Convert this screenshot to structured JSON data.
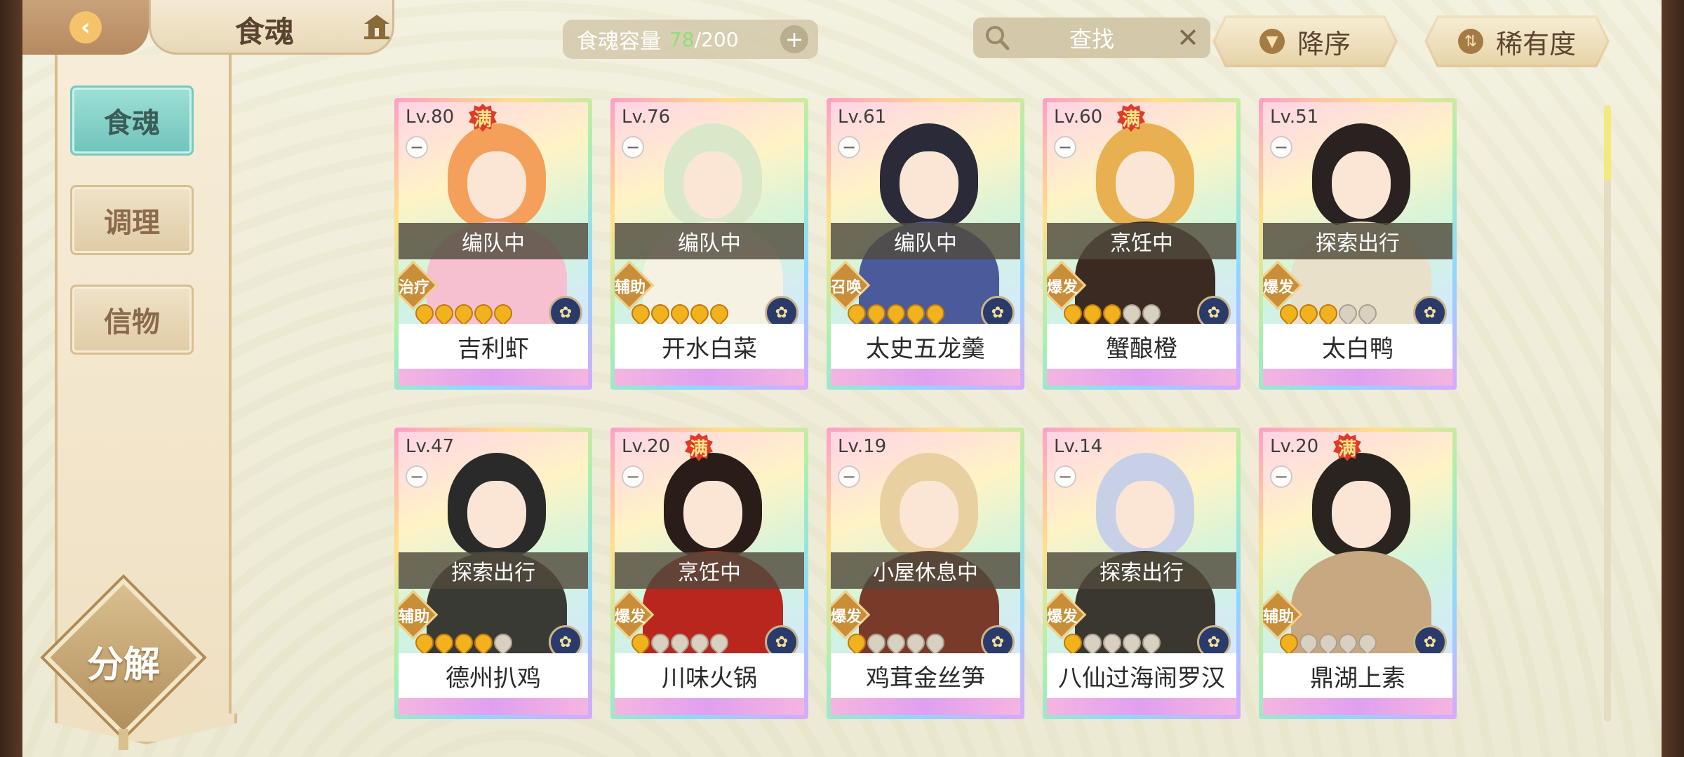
{
  "header": {
    "title": "食魂",
    "capacity_label": "食魂容量",
    "capacity_current": "78",
    "capacity_max": "/200",
    "search_placeholder": "查找",
    "sort_order_label": "降序",
    "sort_key_label": "稀有度"
  },
  "sidebar": {
    "tabs": [
      {
        "label": "食魂",
        "active": true
      },
      {
        "label": "调理",
        "active": false
      },
      {
        "label": "信物",
        "active": false
      }
    ],
    "decompose_label": "分解"
  },
  "cards": [
    {
      "level": "Lv.80",
      "maxed": true,
      "full_label": "满",
      "status": "编队中",
      "role": "治疗",
      "stars_on": 5,
      "stars_total": 5,
      "name": "吉利虾",
      "hair": "#f4a05a",
      "body": "#f7c0d0"
    },
    {
      "level": "Lv.76",
      "maxed": false,
      "full_label": "",
      "status": "编队中",
      "role": "辅助",
      "stars_on": 5,
      "stars_total": 5,
      "name": "开水白菜",
      "hair": "#d8e8c8",
      "body": "#f5f2e4"
    },
    {
      "level": "Lv.61",
      "maxed": false,
      "full_label": "",
      "status": "编队中",
      "role": "召唤",
      "stars_on": 5,
      "stars_total": 5,
      "name": "太史五龙羹",
      "hair": "#2a2a38",
      "body": "#4a5a9a"
    },
    {
      "level": "Lv.60",
      "maxed": true,
      "full_label": "满",
      "status": "烹饪中",
      "role": "爆发",
      "stars_on": 3,
      "stars_total": 5,
      "name": "蟹酿橙",
      "hair": "#e8b050",
      "body": "#3a2a22"
    },
    {
      "level": "Lv.51",
      "maxed": false,
      "full_label": "",
      "status": "探索出行",
      "role": "爆发",
      "stars_on": 3,
      "stars_total": 5,
      "name": "太白鸭",
      "hair": "#2a2220",
      "body": "#e8e0c8"
    },
    {
      "level": "Lv.47",
      "maxed": false,
      "full_label": "",
      "status": "探索出行",
      "role": "辅助",
      "stars_on": 4,
      "stars_total": 5,
      "name": "德州扒鸡",
      "hair": "#2a2a2a",
      "body": "#3a3a34"
    },
    {
      "level": "Lv.20",
      "maxed": true,
      "full_label": "满",
      "status": "烹饪中",
      "role": "爆发",
      "stars_on": 1,
      "stars_total": 5,
      "name": "川味火锅",
      "hair": "#2a1c18",
      "body": "#b8261e"
    },
    {
      "level": "Lv.19",
      "maxed": false,
      "full_label": "",
      "status": "小屋休息中",
      "role": "爆发",
      "stars_on": 1,
      "stars_total": 5,
      "name": "鸡茸金丝笋",
      "hair": "#e8d0a0",
      "body": "#7a3a2a"
    },
    {
      "level": "Lv.14",
      "maxed": false,
      "full_label": "",
      "status": "探索出行",
      "role": "爆发",
      "stars_on": 1,
      "stars_total": 5,
      "name": "八仙过海闹罗汉",
      "hair": "#c8d0e8",
      "body": "#3a3630"
    },
    {
      "level": "Lv.20",
      "maxed": true,
      "full_label": "满",
      "status": "",
      "role": "辅助",
      "stars_on": 1,
      "stars_total": 5,
      "name": "鼎湖上素",
      "hair": "#2a2420",
      "body": "#c8a880"
    }
  ]
}
